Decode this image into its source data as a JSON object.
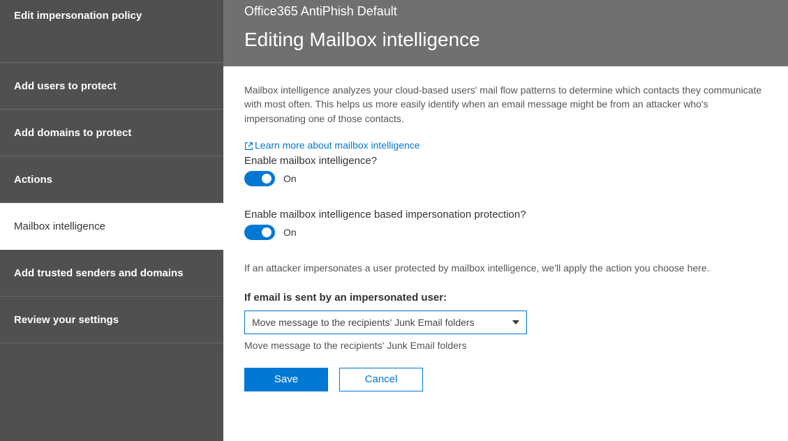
{
  "sidebar": {
    "items": [
      {
        "label": "Edit impersonation policy"
      },
      {
        "label": "Add users to protect"
      },
      {
        "label": "Add domains to protect"
      },
      {
        "label": "Actions"
      },
      {
        "label": "Mailbox intelligence"
      },
      {
        "label": "Add trusted senders and domains"
      },
      {
        "label": "Review your settings"
      }
    ]
  },
  "header": {
    "context": "Office365 AntiPhish Default",
    "title": "Editing Mailbox intelligence"
  },
  "content": {
    "description": "Mailbox intelligence analyzes your cloud-based users' mail flow patterns to determine which contacts they communicate with most often. This helps us more easily identify when an email message might be from an attacker who's impersonating one of those contacts.",
    "learn_more": "Learn more about mailbox intelligence",
    "toggle1_label": "Enable mailbox intelligence?",
    "toggle1_state": "On",
    "toggle2_label": "Enable mailbox intelligence based impersonation protection?",
    "toggle2_state": "On",
    "action_desc": "If an attacker impersonates a user protected by mailbox intelligence, we'll apply the action you choose here.",
    "select_label": "If email is sent by an impersonated user:",
    "select_value": "Move message to the recipients' Junk Email folders",
    "select_echo": "Move message to the recipients' Junk Email folders",
    "save_label": "Save",
    "cancel_label": "Cancel"
  }
}
